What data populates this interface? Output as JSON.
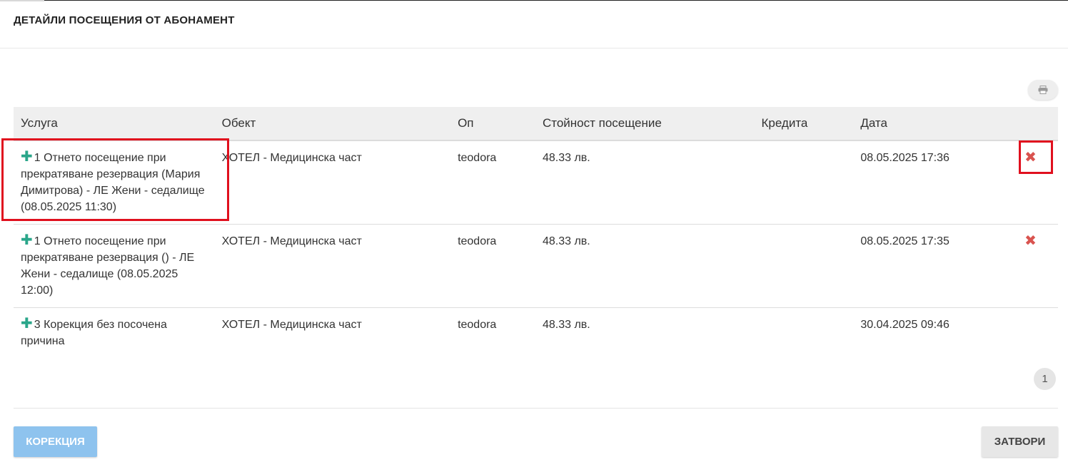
{
  "dialog": {
    "title": "ДЕТАЙЛИ ПОСЕЩЕНИЯ ОТ АБОНАМЕНТ"
  },
  "table": {
    "headers": [
      "Услуга",
      "Обект",
      "Оп",
      "Стойност посещение",
      "Кредита",
      "Дата",
      ""
    ],
    "rows": [
      {
        "service": "1 Отнето посещение при прекратяване резервация (Мария Димитрова) - ЛЕ Жени - седалище (08.05.2025 11:30)",
        "object": "ХОТЕЛ - Медицинска част",
        "op": "teodora",
        "value": "48.33 лв.",
        "credits": "",
        "date": "08.05.2025 17:36",
        "delete": "✖"
      },
      {
        "service": "1 Отнето посещение при прекратяване резервация () - ЛЕ Жени - седалище (08.05.2025 12:00)",
        "object": "ХОТЕЛ - Медицинска част",
        "op": "teodora",
        "value": "48.33 лв.",
        "credits": "",
        "date": "08.05.2025 17:35",
        "delete": "✖"
      },
      {
        "service": "3 Корекция без посочена причина",
        "object": "ХОТЕЛ - Медицинска част",
        "op": "teodora",
        "value": "48.33 лв.",
        "credits": "",
        "date": "30.04.2025 09:46",
        "delete": ""
      }
    ]
  },
  "pagination": {
    "current_page": "1"
  },
  "footer": {
    "correction_label": "КОРЕКЦИЯ",
    "close_label": "ЗАТВОРИ"
  },
  "icons": {
    "expand": "plus-icon",
    "remove": "delete-icon",
    "print": "print-icon"
  },
  "colors": {
    "expand": "#2aa68a",
    "remove": "#d9534f",
    "highlight": "#e0101e",
    "primary_button": "#8ec3ee"
  }
}
